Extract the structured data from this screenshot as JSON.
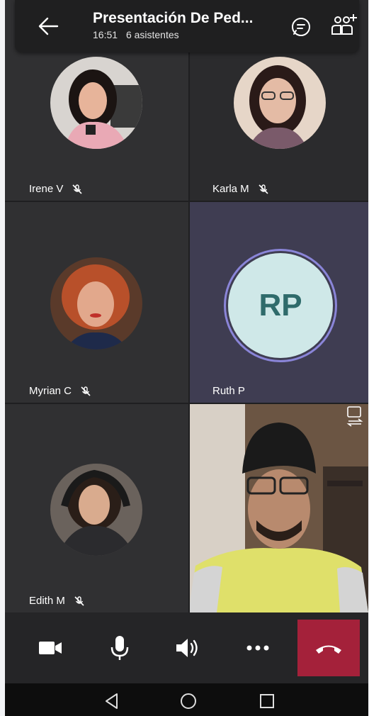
{
  "header": {
    "title": "Presentación De Ped...",
    "time": "16:51",
    "attendees": "6 asistentes",
    "icons": [
      "back-arrow-icon",
      "chat-icon",
      "add-people-icon"
    ]
  },
  "participants": [
    {
      "name": "Irene V",
      "muted": true
    },
    {
      "name": "Karla M",
      "muted": true
    },
    {
      "name": "Myrian C",
      "muted": true
    },
    {
      "name": "Ruth P",
      "initials": "RP",
      "muted": false
    },
    {
      "name": "Edith M",
      "muted": true
    },
    {
      "name": "",
      "self_video": true
    }
  ],
  "controls": {
    "icons": [
      "camera-icon",
      "microphone-icon",
      "speaker-icon",
      "more-icon",
      "hang-up-icon"
    ]
  },
  "colors": {
    "accent_ring": "#8a85d8",
    "initials_bg": "#cfe8e8",
    "initials_text": "#2f6b6b",
    "hangup": "#a4213a"
  }
}
